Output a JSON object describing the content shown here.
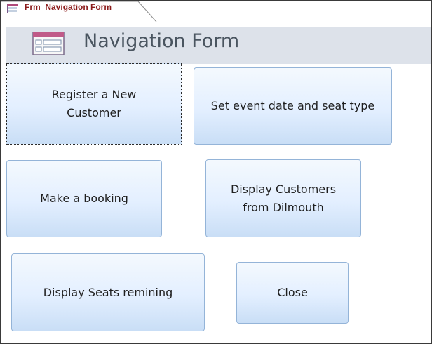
{
  "tab": {
    "title": "Frm_Navigation Form",
    "icon": "form-icon"
  },
  "header": {
    "title": "Navigation Form",
    "icon": "form-icon"
  },
  "buttons": {
    "register": "Register a New Customer",
    "set_event": "Set event date and seat type",
    "make_booking": "Make a booking",
    "display_customers": "Display Customers from Dilmouth",
    "display_seats": "Display Seats remining",
    "close": "Close"
  },
  "colors": {
    "tab_text": "#8b1a1a",
    "header_bg": "#dde2ea",
    "header_text": "#4a5560",
    "button_border": "#94b4d8",
    "button_top": "#f4f9fe",
    "button_bottom": "#c9def6"
  }
}
